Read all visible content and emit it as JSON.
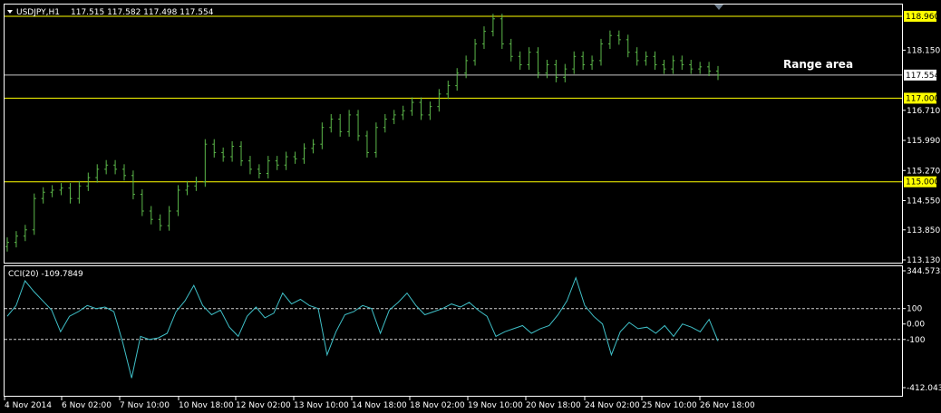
{
  "header": {
    "symbol": "USDJPY,H1",
    "ohlc": "117.515 117.582 117.498 117.554"
  },
  "annotation": "Range area",
  "colors": {
    "background": "#000000",
    "candles": "#5cb84a",
    "level_line": "#ffff00",
    "price_line": "#c8c8c8",
    "cci": "#3fc0c8",
    "border": "#ffffff"
  },
  "chart_data": [
    {
      "type": "bar",
      "name": "USDJPY,H1",
      "ylim": [
        113.13,
        118.96
      ],
      "y_ticks": [
        "118.960",
        "118.150",
        "117.554",
        "117.000",
        "116.710",
        "115.990",
        "115.270",
        "115.000",
        "114.550",
        "113.850",
        "113.130"
      ],
      "highlighted": [
        "118.960",
        "117.000",
        "115.000"
      ],
      "current": "117.554",
      "levels": [
        118.96,
        117.0,
        115.0
      ],
      "last_price": 117.554,
      "x_labels": [
        "4 Nov 2014",
        "6 Nov 02:00",
        "7 Nov 10:00",
        "10 Nov 18:00",
        "12 Nov 02:00",
        "13 Nov 10:00",
        "14 Nov 18:00",
        "18 Nov 02:00",
        "19 Nov 10:00",
        "20 Nov 18:00",
        "24 Nov 02:00",
        "25 Nov 10:00",
        "26 Nov 18:00"
      ],
      "closes": [
        113.55,
        113.7,
        113.85,
        114.6,
        114.75,
        114.8,
        114.85,
        114.6,
        114.9,
        115.1,
        115.3,
        115.4,
        115.3,
        115.15,
        114.7,
        114.3,
        114.1,
        113.95,
        114.3,
        114.8,
        114.9,
        115.0,
        115.9,
        115.7,
        115.6,
        115.85,
        115.5,
        115.3,
        115.2,
        115.5,
        115.4,
        115.6,
        115.55,
        115.8,
        115.9,
        116.3,
        116.5,
        116.2,
        116.6,
        116.1,
        115.7,
        116.3,
        116.5,
        116.6,
        116.7,
        116.9,
        116.6,
        116.8,
        117.1,
        117.3,
        117.6,
        117.9,
        118.3,
        118.6,
        118.9,
        118.3,
        118.0,
        117.8,
        118.1,
        117.6,
        117.8,
        117.5,
        117.7,
        118.0,
        117.8,
        117.9,
        118.3,
        118.5,
        118.4,
        118.1,
        117.9,
        118.0,
        117.8,
        117.7,
        117.9,
        117.8,
        117.7,
        117.75,
        117.65,
        117.554
      ]
    },
    {
      "type": "line",
      "name": "CCI(20)",
      "label": "CCI(20) -109.7849",
      "ylim": [
        -412.0435,
        344.5732
      ],
      "y_ticks": [
        "344.5732",
        "100",
        "0.00",
        "-100",
        "-412.0435"
      ],
      "levels": [
        100,
        -100
      ],
      "values": [
        50,
        120,
        280,
        210,
        150,
        90,
        -50,
        50,
        80,
        120,
        100,
        110,
        80,
        -120,
        -350,
        -80,
        -100,
        -90,
        -60,
        80,
        150,
        250,
        120,
        60,
        90,
        -20,
        -80,
        50,
        110,
        40,
        70,
        200,
        130,
        160,
        120,
        100,
        -200,
        -50,
        60,
        80,
        120,
        100,
        -60,
        90,
        140,
        200,
        120,
        60,
        80,
        100,
        130,
        110,
        140,
        90,
        50,
        -80,
        -50,
        -30,
        -10,
        -60,
        -30,
        -10,
        60,
        150,
        300,
        120,
        50,
        0,
        -200,
        -50,
        10,
        -30,
        -20,
        -60,
        -10,
        -80,
        0,
        -20,
        -50,
        30,
        -109.7849
      ]
    }
  ]
}
